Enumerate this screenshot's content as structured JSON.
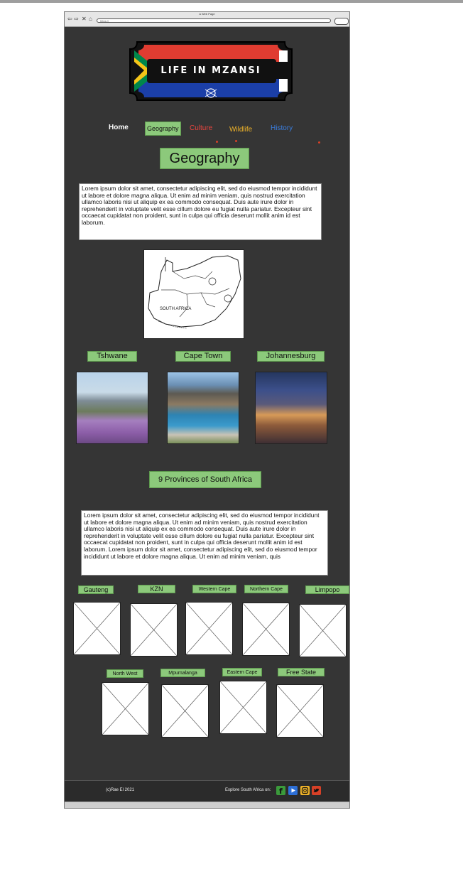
{
  "browser": {
    "tab_title": "A Web Page",
    "address": "https://"
  },
  "logo": {
    "text": "LIFE IN MZANSI"
  },
  "nav": {
    "home": "Home",
    "geography": "Geography",
    "culture": "Culture",
    "wildlife": "Wildlife",
    "history": "History"
  },
  "main": {
    "heading": "Geography",
    "intro_text": "Lorem ipsum dolor sit amet, consectetur adipiscing elit, sed do eiusmod tempor incididunt ut labore et dolore magna aliqua. Ut enim ad minim veniam, quis nostrud exercitation ullamco laboris nisi ut aliquip ex ea commodo consequat. Duis aute irure dolor in reprehenderit in voluptate velit esse cillum dolore eu fugiat nulla pariatur. Excepteur sint occaecat cupidatat non proident, sunt in culpa qui officia deserunt mollit anim id est laborum.",
    "map_label": "SOUTH AFRICA",
    "cities": [
      "Tshwane",
      "Cape Town",
      "Johannesburg"
    ],
    "provinces_heading": "9 Provinces of South Africa",
    "provinces_text": "Lorem ipsum dolor sit amet, consectetur adipiscing elit, sed do eiusmod tempor incididunt ut labore et dolore magna aliqua. Ut enim ad minim veniam, quis nostrud exercitation ullamco laboris nisi ut aliquip ex ea commodo consequat. Duis aute irure dolor in reprehenderit in voluptate velit esse cillum dolore eu fugiat nulla pariatur. Excepteur sint occaecat cupidatat non proident, sunt in culpa qui officia deserunt mollit anim id est laborum. Lorem ipsum dolor sit amet, consectetur adipiscing elit, sed do eiusmod tempor incididunt ut labore et dolore magna aliqua. Ut enim ad minim veniam, quis",
    "provinces_row1": [
      "Gauteng",
      "KZN",
      "Western Cape",
      "Northern Cape",
      "Limpopo"
    ],
    "provinces_row2": [
      "North West",
      "Mpumalanga",
      "Eastern Cape",
      "Free State"
    ]
  },
  "footer": {
    "copyright": "(c)Rae El 2021",
    "explore": "Explore South Africa on:",
    "social_icons": [
      "facebook-icon",
      "youtube-icon",
      "instagram-icon",
      "twitter-icon"
    ]
  },
  "colors": {
    "page_bg": "#353535",
    "label_green": "#8cc97b",
    "culture": "#e8453f",
    "wildlife": "#f0b429",
    "history": "#3a7dde"
  }
}
